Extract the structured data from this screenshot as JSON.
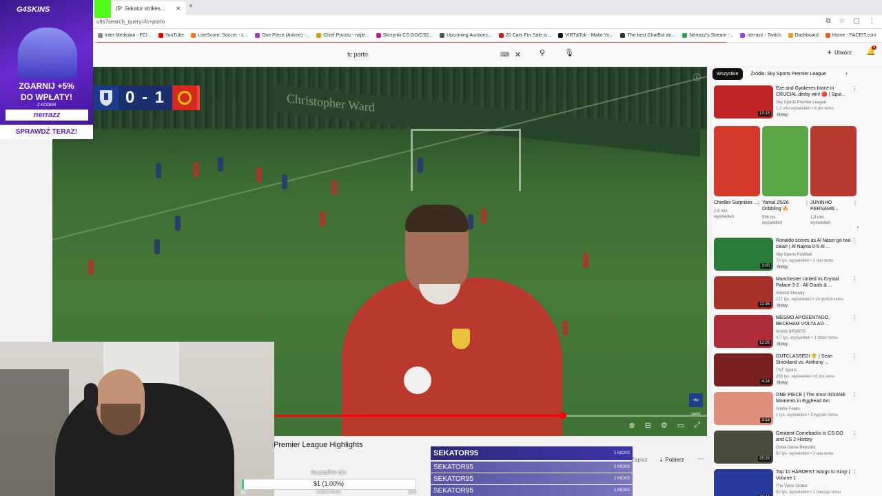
{
  "browser": {
    "tabs": [
      {
        "label": "(9) Sekator strikes...",
        "active": true
      }
    ],
    "url": "ults?search_query=fc+porto",
    "bookmarks": [
      "Inter Mediolan - FCI...",
      "YouTube",
      "LiveScore: Soccer - L...",
      "One Piece (Anime) -...",
      "Chief Pocztu - najle...",
      "Skrzynki CS:GO/CS2...",
      "Upcoming Auctions...",
      "20 Cars For Sale in...",
      "VIRT&Tok - Make Yo...",
      "The best ChatBot an...",
      "Nerrazz's Stream -...",
      "nerrazz - Twitch",
      "Dashboard",
      "Home - FACEIT.com"
    ]
  },
  "youtube": {
    "search_value": "fc porto",
    "create_label": "Utwórz",
    "notification_count": "9"
  },
  "video": {
    "score": "0 - 1",
    "progress": 0.78,
    "title": "Premier League Highlights",
    "channel_logo": "sky sports",
    "pitch_boards": "Christopher Ward",
    "save_label": "Zapisz",
    "download_label": "Pobierz"
  },
  "sidebar": {
    "chips": [
      "Wszystkie",
      "Źródło: Sky Sports Premier League"
    ],
    "top_rec": {
      "title": "Eze and Gyokeres brace in CRUCIAL derby win! 🔴 | Spur...",
      "channel": "Sky Sports Premier League",
      "meta": "1,2 mln wyświetleń • 6 dni temu",
      "badge": "Nowy",
      "duration": "13:15",
      "thumb_color": "#c02424"
    },
    "shorts": [
      {
        "title": "Chiellini Surprises ...",
        "views": "2,6 mln",
        "views_label": "wyświetleń",
        "color": "#d63a2a"
      },
      {
        "title": "Yamal 25/26 Dribbling 🔥",
        "views": "596 tys.",
        "views_label": "wyświetleń",
        "color": "#5aa845"
      },
      {
        "title": "JUNINHO PERNAMB...",
        "views": "1,9 mln",
        "views_label": "wyświetleń",
        "color": "#b83a2e"
      }
    ],
    "recs": [
      {
        "title": "Ronaldo scores as Al Nassr go two clear! | Al Najma 0-5 Al ...",
        "channel": "Sky Sports Football",
        "meta": "70 tys. wyświetleń • 1 min temu",
        "badge": "Nowy",
        "duration": "3:00",
        "thumb_color": "#2a7a3a"
      },
      {
        "title": "Manchester United vs Crystal Palace 3-2 · All Goals & ...",
        "channel": "Ahmed Showky",
        "meta": "217 tys. wyświetleń • 14 godzin temu",
        "badge": "Nowy",
        "duration": "11:36",
        "thumb_color": "#a8322a"
      },
      {
        "title": "MESMO APOSENTADO, BECKHAM VOLTA AO ...",
        "channel": "SHAN SPORTS",
        "meta": "4,7 tys. wyświetleń • 1 dzień temu",
        "badge": "Nowy",
        "duration": "12:26",
        "thumb_color": "#b02c3a"
      },
      {
        "title": "OUTCLASSED! 😤 | Sean Strickland vs. Anthony ...",
        "channel": "TNT Sports",
        "meta": "263 tys. wyświetleń • 6 dni temu",
        "badge": "Nowy",
        "duration": "4:14",
        "thumb_color": "#7a1f1f"
      },
      {
        "title": "ONE PIECE | The most INSANE Moments in Egghead Arc",
        "channel": "Anime Feaks",
        "meta": "1 tys. wyświetleń • 5 tygodni temu",
        "badge": "",
        "duration": "3:13",
        "thumb_color": "#e0907a"
      },
      {
        "title": "Greatest Comebacks in CS:GO and CS 2 History",
        "channel": "Good Game Republic",
        "meta": "82 tys. wyświetleń • 2 lata temu",
        "badge": "",
        "duration": "25:28",
        "thumb_color": "#4a4a3a"
      },
      {
        "title": "Top 10 HARDEST Songs to Sing! | Volume 1",
        "channel": "The Voice Global",
        "meta": "50 tys. wyświetleń • 1 miesiąc temu",
        "badge": "",
        "duration": "20:44",
        "thumb_color": "#2a3a9a"
      }
    ]
  },
  "overlays": {
    "ad": {
      "logo": "G4SKINS",
      "line1": "ZGARNIJ +5%",
      "line2": "DO WPŁATY!",
      "small": "Z KODEM",
      "code": "nerrazz",
      "cta": "SPRAWDŹ TERAZ!"
    },
    "kick_logo_text": "2",
    "donation": {
      "label": "Na prąd/For bills",
      "amount": "$1 (1.00%)",
      "fraction": 0.01,
      "days": "6 DAYS TO GO",
      "min": "$0",
      "max": "$100"
    },
    "kicks": [
      {
        "name": "SEKATOR95",
        "count": "1 KICKS"
      },
      {
        "name": "SEKATOR95",
        "count": "1 KICKS"
      },
      {
        "name": "SEKATOR95",
        "count": "1 KICKS"
      },
      {
        "name": "SEKATOR95",
        "count": "1 KICKS"
      }
    ]
  },
  "colors": {
    "yt_red": "#ff0000",
    "kick_green": "#53fc18",
    "ad_purple": "#6a2ad0"
  }
}
